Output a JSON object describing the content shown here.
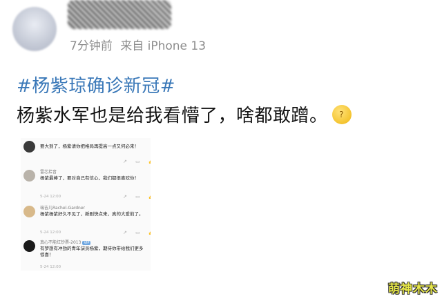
{
  "post": {
    "time": "7分钟前",
    "source": "来自 iPhone 13",
    "hashtag": "#杨紫琼确诊新冠#",
    "text": "杨紫水军也是给我看懵了，啥都敢蹭。",
    "emoji": "thinking-face-emoji"
  },
  "embedded_comments": [
    {
      "username": "",
      "text": "要大到了，杨紫请你把格局再提高一点又何必来！",
      "date": "",
      "avatar_color": "#3a3a3a"
    },
    {
      "username": "雷芯拾音",
      "text": "杨紫最棒了，要对自己有信心，我们都很喜欢你！",
      "date": "5-24 12:00",
      "avatar_color": "#b9b3aa"
    },
    {
      "username": "瑞吉儿Rachel-Gardner",
      "text": "杨紫杨紫好久不见了，新剧快点来，真的大爱煎了。",
      "date": "5-24 12:00",
      "avatar_color": "#d8b98a"
    },
    {
      "username": "真心不能红钞票-2013",
      "vip": "VIP",
      "text": "有梦想有冲劲的青年演员杨紫，期待你带给我们更多惊喜！",
      "date": "5-24 12:00",
      "avatar_color": "#1a1a1a"
    }
  ],
  "actions": {
    "icons": [
      "share-icon",
      "comment-icon",
      "like-icon"
    ],
    "glyphs": "↗ ▭ 👍"
  },
  "watermark": "萌神木木"
}
